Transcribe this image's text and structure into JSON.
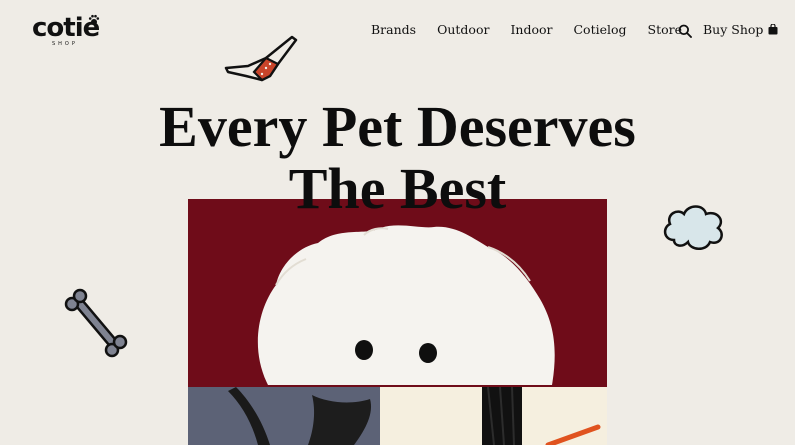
{
  "brand": {
    "logo_text": "cotie",
    "logo_sub": "SHOP"
  },
  "nav": {
    "items": [
      "Brands",
      "Outdoor",
      "Indoor",
      "Cotielog",
      "Store"
    ]
  },
  "header": {
    "buy_label": "Buy Shop"
  },
  "hero": {
    "title_line1": "Every Pet Deserves",
    "title_line2": "The Best"
  },
  "icons": {
    "search": "search-icon",
    "bag": "shopping-bag-icon",
    "paw": "paw-icon"
  },
  "colors": {
    "background": "#efece6",
    "panel_red": "#6f0c19",
    "panel_slate": "#5c6276",
    "dog_white": "#f5f3ef",
    "text": "#111111",
    "accent_orange": "#e0531f",
    "cloud_blue": "#d8e6ea"
  }
}
